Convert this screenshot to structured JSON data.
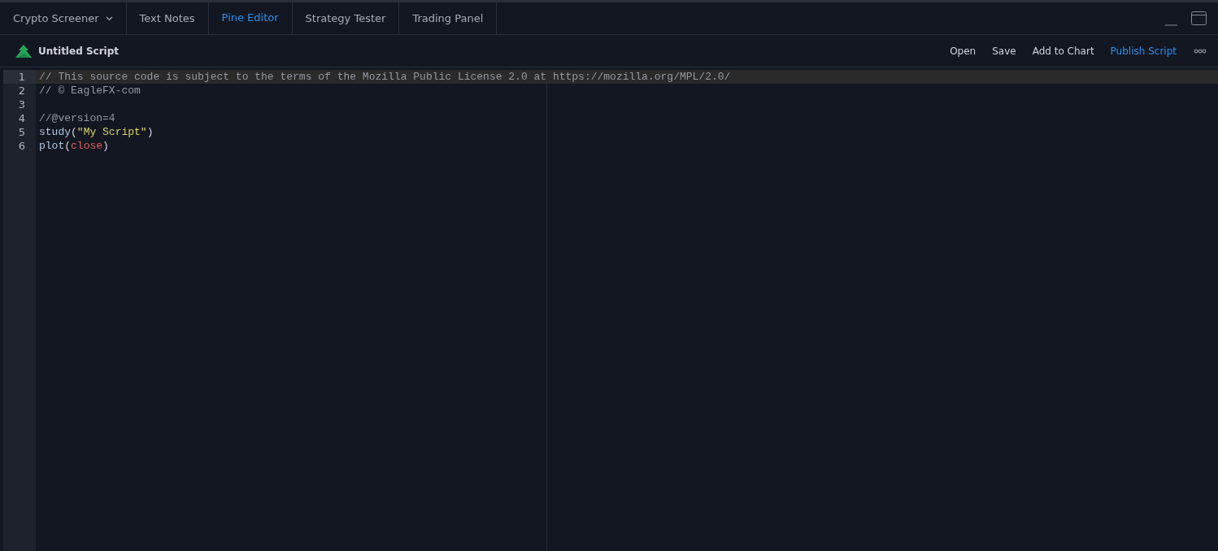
{
  "tabs": [
    {
      "label": "Crypto Screener",
      "selected": false,
      "kind": "dropdown"
    },
    {
      "label": "Text Notes",
      "selected": false,
      "kind": "plain"
    },
    {
      "label": "Pine Editor",
      "selected": true,
      "kind": "plain"
    },
    {
      "label": "Strategy Tester",
      "selected": false,
      "kind": "plain"
    },
    {
      "label": "Trading Panel",
      "selected": false,
      "kind": "plain"
    }
  ],
  "toolbar": {
    "title": "Untitled Script",
    "actions": [
      {
        "label": "Open",
        "kind": "normal"
      },
      {
        "label": "Save",
        "kind": "normal"
      },
      {
        "label": "Add to Chart",
        "kind": "normal"
      },
      {
        "label": "Publish Script",
        "kind": "primary"
      }
    ]
  },
  "editor": {
    "lines": [
      {
        "number": "1",
        "current": true,
        "tokens": [
          {
            "text": "// This source code is subject to the terms of the Mozilla Public License 2.0 at https://mozilla.org/MPL/2.0/",
            "kind": "comment"
          }
        ]
      },
      {
        "number": "2",
        "current": false,
        "tokens": [
          {
            "text": "// © EagleFX-com",
            "kind": "comment"
          }
        ]
      },
      {
        "number": "3",
        "current": false
      },
      {
        "number": "4",
        "current": false,
        "tokens": [
          {
            "text": "//@version=4",
            "kind": "comment"
          }
        ]
      },
      {
        "number": "5",
        "current": false,
        "tokens": [
          {
            "text": "study",
            "kind": "func"
          },
          {
            "text": "(",
            "kind": "punct"
          },
          {
            "text": "\"My Script\"",
            "kind": "string"
          },
          {
            "text": ")",
            "kind": "punct"
          }
        ]
      },
      {
        "number": "6",
        "current": false,
        "tokens": [
          {
            "text": "plot",
            "kind": "func"
          },
          {
            "text": "(",
            "kind": "punct"
          },
          {
            "text": "close",
            "kind": "var"
          },
          {
            "text": ")",
            "kind": "punct"
          }
        ]
      }
    ]
  }
}
